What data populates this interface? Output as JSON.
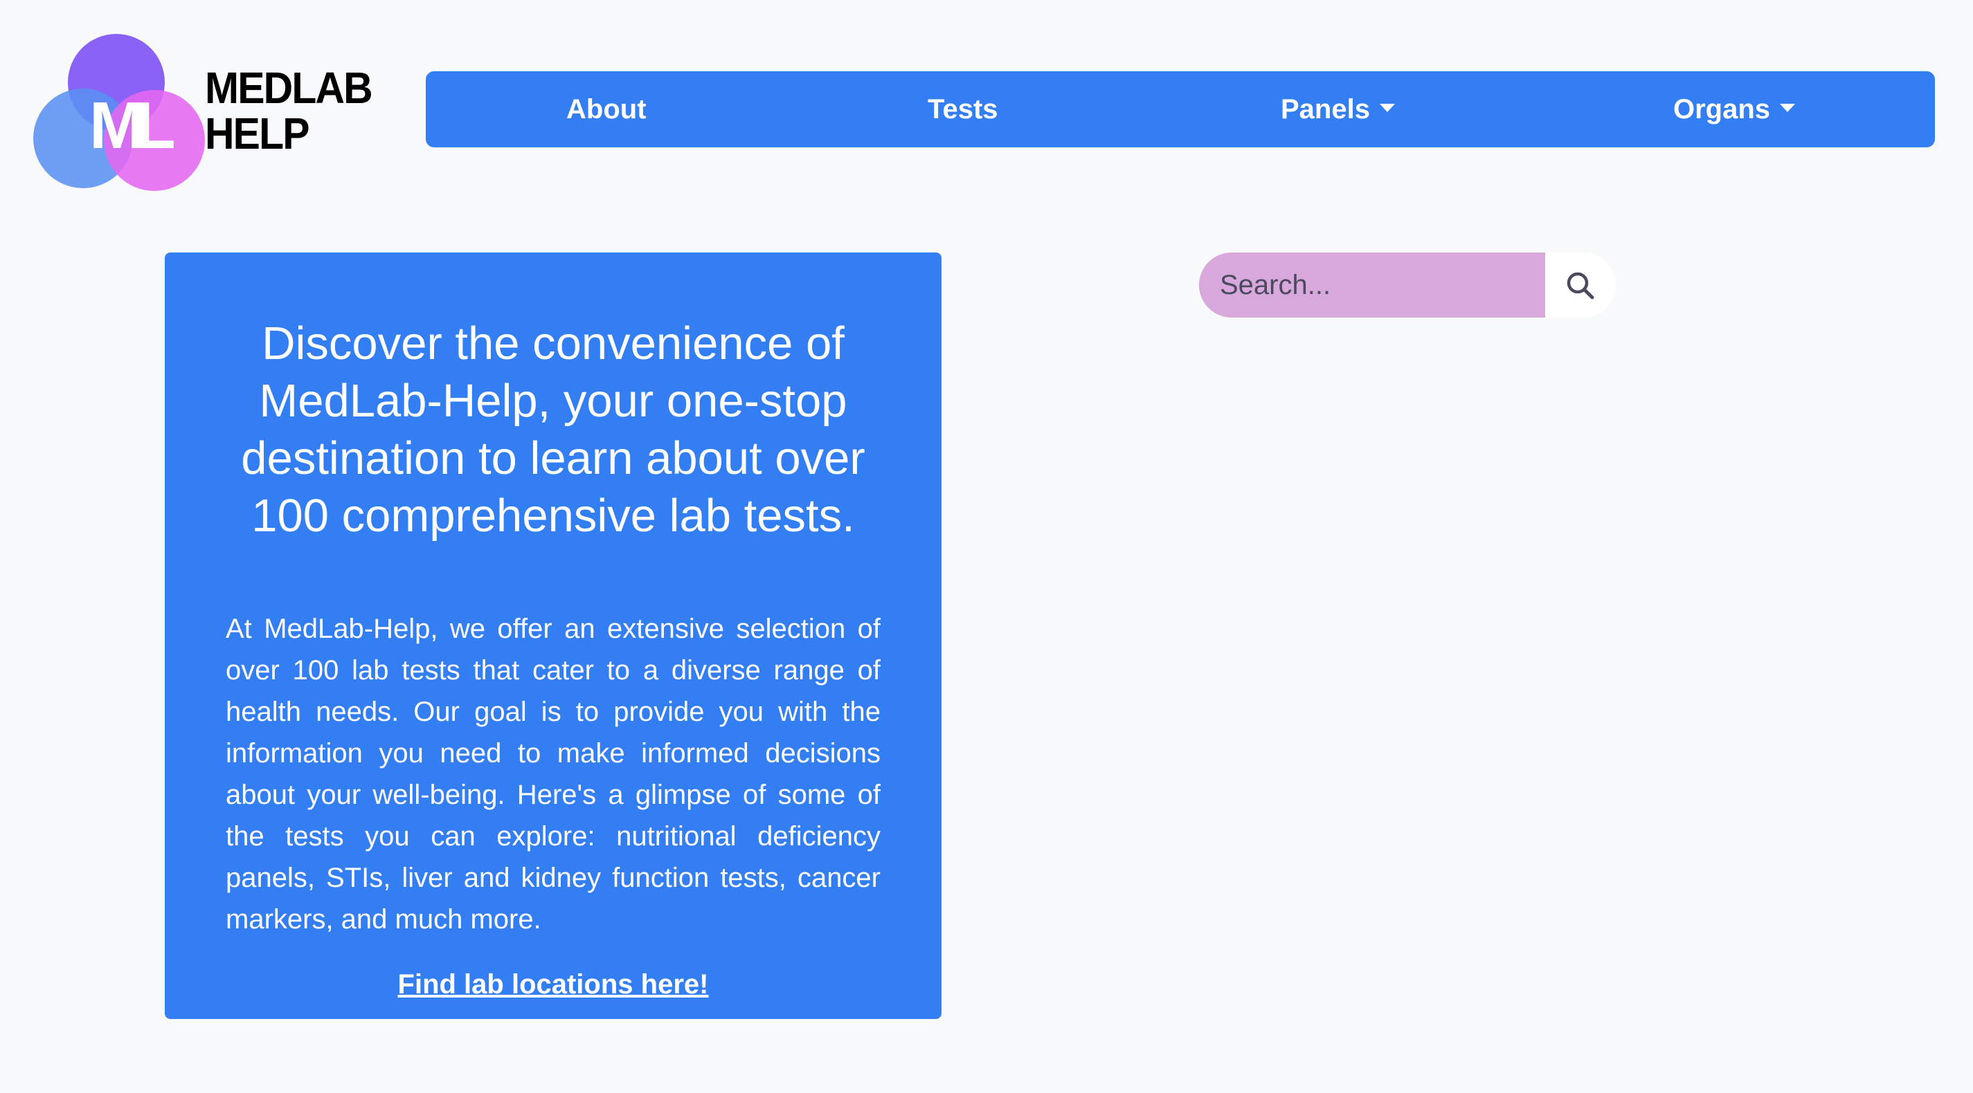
{
  "logo": {
    "mark": "ML",
    "line1": "MEDLAB",
    "line2": "HELP",
    "colors": [
      "#7a4df5",
      "#5a8ff2",
      "#e468f0"
    ]
  },
  "nav": {
    "about": "About",
    "tests": "Tests",
    "panels": "Panels",
    "organs": "Organs",
    "color": "#327ef2"
  },
  "hero": {
    "title": "Discover the convenience of MedLab-Help, your one-stop destination to learn about over 100 comprehensive lab tests.",
    "body": "At MedLab-Help, we offer an extensive selection of over 100 lab tests that cater to a diverse range of health needs. Our goal is to provide you with the information you need to make informed decisions about your well-being. Here's a glimpse of some of the tests you can explore: nutritional deficiency panels, STIs, liver and kidney function tests, cancer markers, and much more.",
    "link": "Find lab locations here!"
  },
  "search": {
    "placeholder": "Search...",
    "value": "",
    "icon": "search-icon",
    "input_color": "#d8a8dc"
  }
}
